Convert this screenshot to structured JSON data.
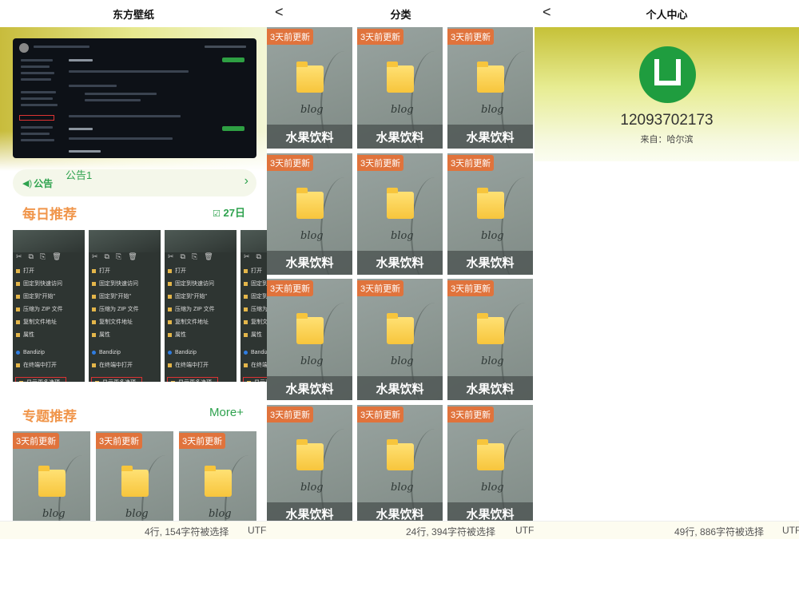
{
  "panel1": {
    "title": "东方壁纸",
    "notice": {
      "label": "公告",
      "text": "公告1"
    },
    "daily": {
      "title": "每日推荐",
      "date": "27日",
      "items": [
        {
          "menu": [
            "打开",
            "固定到快速访问",
            "固定到\"开始\"",
            "压缩为 ZIP 文件",
            "复制文件地址",
            "属性",
            "Bandizip",
            "在终端中打开",
            "显示更多选项"
          ]
        }
      ]
    },
    "topics": {
      "title": "专题推荐",
      "more": "More+",
      "tag": "3天前更新",
      "word": "blog"
    },
    "status": {
      "selection": "4行, 154字符被选择",
      "encoding": "UTF-"
    }
  },
  "panel2": {
    "title": "分类",
    "back": "<",
    "tiles": [
      {
        "tag": "3天前更新",
        "word": "blog",
        "caption": "水果饮料"
      },
      {
        "tag": "3天前更新",
        "word": "blog",
        "caption": "水果饮料"
      },
      {
        "tag": "3天前更新",
        "word": "blog",
        "caption": "水果饮料"
      },
      {
        "tag": "3天前更新",
        "word": "blog",
        "caption": "水果饮料"
      },
      {
        "tag": "3天前更新",
        "word": "blog",
        "caption": "水果饮料"
      },
      {
        "tag": "3天前更新",
        "word": "blog",
        "caption": "水果饮料"
      },
      {
        "tag": "3天前更新",
        "word": "blog",
        "caption": "水果饮料"
      },
      {
        "tag": "3天前更新",
        "word": "blog",
        "caption": "水果饮料"
      },
      {
        "tag": "3天前更新",
        "word": "blog",
        "caption": "水果饮料"
      },
      {
        "tag": "3天前更新",
        "word": "blog",
        "caption": "水果饮料"
      },
      {
        "tag": "3天前更新",
        "word": "blog",
        "caption": "水果饮料"
      },
      {
        "tag": "3天前更新",
        "word": "blog",
        "caption": "水果饮料"
      }
    ],
    "status": {
      "selection": "24行, 394字符被选择",
      "encoding": "UTF"
    }
  },
  "panel3": {
    "title": "个人中心",
    "back": "<",
    "user_id": "12093702173",
    "from": "来自：哈尔滨",
    "status": {
      "selection": "49行, 886字符被选择",
      "encoding": "UTF"
    }
  },
  "colors": {
    "accent_green": "#2ea24e",
    "accent_orange": "#f0954a",
    "tag_orange": "#e0733c"
  }
}
